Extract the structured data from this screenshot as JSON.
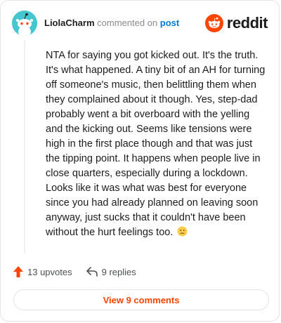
{
  "header": {
    "username": "LiolaCharm",
    "commented_on_text": "commented on",
    "post_link": "post",
    "brand": "reddit"
  },
  "comment": {
    "text": "NTA for saying you got kicked out. It's the truth. It's what happened. A tiny bit of an AH for turning off someone's music, then belittling them when they complained about it though. Yes, step-dad probably went a bit overboard with the yelling and the kicking out. Seems like tensions were high in the first place though and that was just the tipping point. It happens when people live in close quarters, especially during a lockdown. Looks like it was what was best for everyone since you had already planned on leaving soon anyway, just sucks that it couldn't have been without the hurt feelings too.",
    "emoji": "slightly-frowning-face"
  },
  "actions": {
    "upvotes": "13 upvotes",
    "replies": "9 replies"
  },
  "view_button": {
    "label": "View 9 comments"
  },
  "colors": {
    "accent": "#ff4500",
    "link": "#0079d3",
    "avatar": "#46c6cf"
  }
}
